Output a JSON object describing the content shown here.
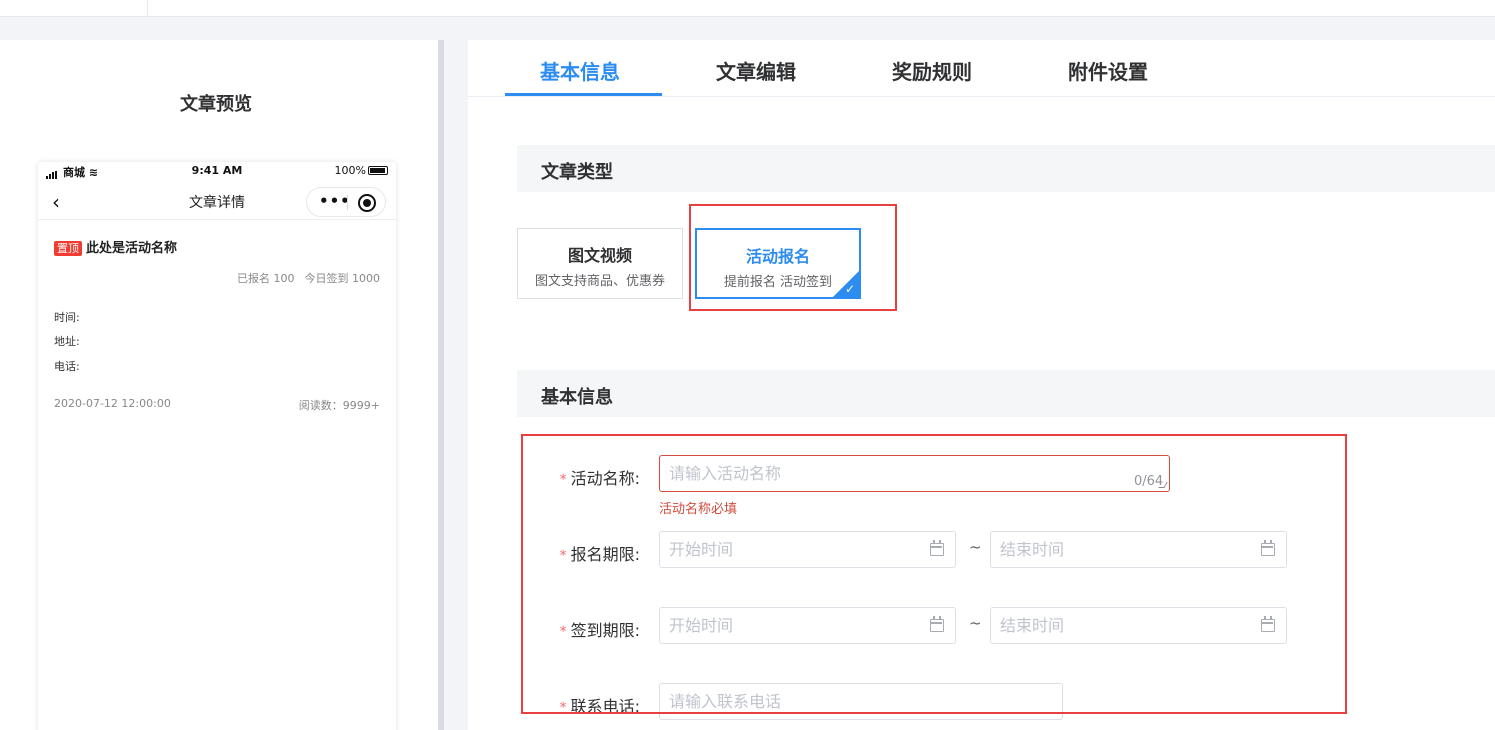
{
  "preview": {
    "title": "文章预览",
    "status": {
      "carrier": "商城",
      "time": "9:41 AM",
      "battery": "100%"
    },
    "nav_title": "文章详情",
    "capsule_dots": "•••",
    "top_tag": "置顶",
    "activity_name": "此处是活动名称",
    "stats": {
      "signed": "已报名 100",
      "checkin_today": "今日签到 1000"
    },
    "info": {
      "time_label": "时间:",
      "address_label": "地址:",
      "phone_label": "电话:"
    },
    "date": "2020-07-12 12:00:00",
    "reads": "阅读数：9999+"
  },
  "tabs": [
    {
      "label": "基本信息",
      "active": true
    },
    {
      "label": "文章编辑",
      "active": false
    },
    {
      "label": "奖励规则",
      "active": false
    },
    {
      "label": "附件设置",
      "active": false
    }
  ],
  "sections": {
    "article_type": "文章类型",
    "basic_info": "基本信息"
  },
  "type_cards": [
    {
      "title": "图文视频",
      "desc": "图文支持商品、优惠券",
      "selected": false
    },
    {
      "title": "活动报名",
      "desc": "提前报名 活动签到",
      "selected": true
    }
  ],
  "form": {
    "required_mark": "*",
    "activity_name": {
      "label": "活动名称:",
      "placeholder": "请输入活动名称",
      "counter": "0/64",
      "error": "活动名称必填"
    },
    "signup_period": {
      "label": "报名期限:",
      "start_placeholder": "开始时间",
      "end_placeholder": "结束时间"
    },
    "checkin_period": {
      "label": "签到期限:",
      "start_placeholder": "开始时间",
      "end_placeholder": "结束时间"
    },
    "phone": {
      "label": "联系电话:",
      "placeholder": "请输入联系电话"
    },
    "range_separator": "~"
  },
  "colors": {
    "accent": "#2d8cf0",
    "error": "#d44c3c",
    "highlight_box": "#e84040",
    "required": "#f56c6c"
  },
  "icons": {
    "calendar": "calendar-icon",
    "back": "chevron-left-icon",
    "check": "check-icon",
    "more": "more-dots-icon",
    "target": "target-icon"
  }
}
